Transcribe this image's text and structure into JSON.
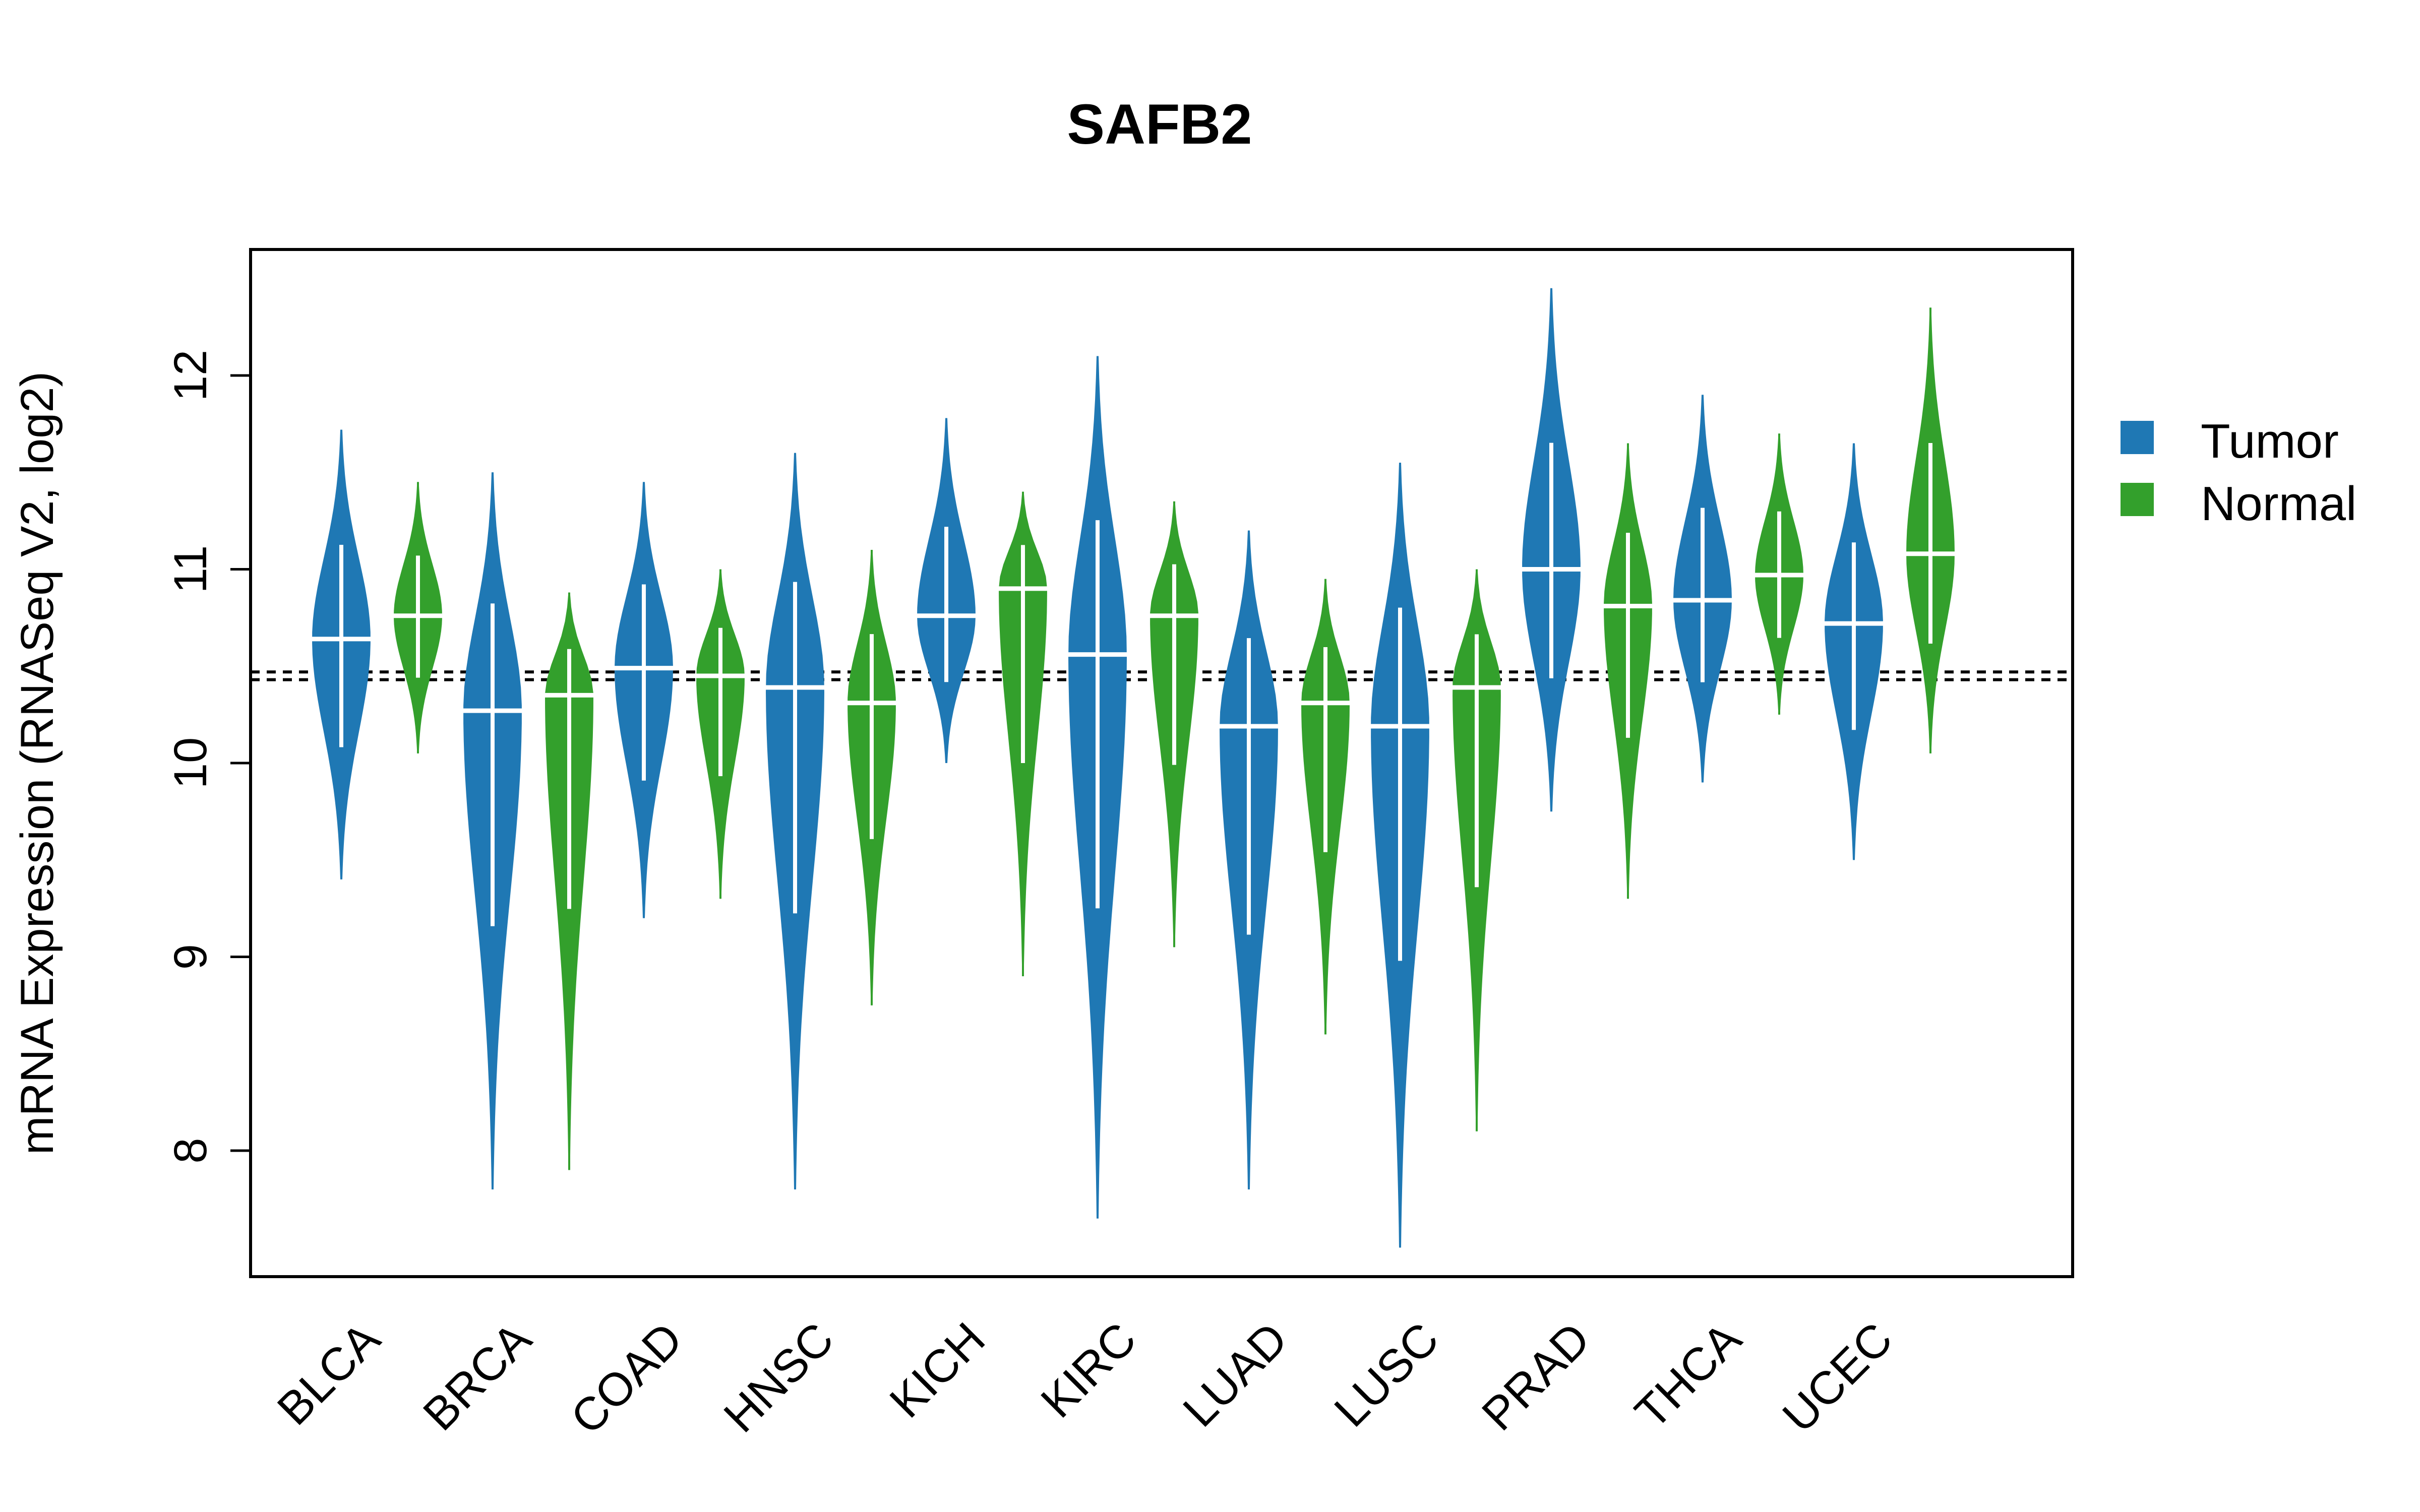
{
  "chart_data": {
    "type": "violin",
    "title": "SAFB2",
    "xlabel": "",
    "ylabel": "mRNA Expression (RNASeq V2, log2)",
    "ylim": [
      7.35,
      12.65
    ],
    "yticks": [
      8,
      9,
      10,
      11,
      12
    ],
    "ytick_labels": [
      "8",
      "9",
      "10",
      "11",
      "12"
    ],
    "grid": false,
    "reference_lines": [
      10.43,
      10.47
    ],
    "legend": {
      "position": "right",
      "entries": [
        {
          "name": "Tumor",
          "color": "#1F78B4"
        },
        {
          "name": "Normal",
          "color": "#33A02C"
        }
      ]
    },
    "categories": [
      "BLCA",
      "BRCA",
      "COAD",
      "HNSC",
      "KICH",
      "KIRC",
      "LUAD",
      "LUSC",
      "PRAD",
      "THCA",
      "UCEC"
    ],
    "series": [
      {
        "name": "Tumor",
        "color": "#1F78B4",
        "median": [
          10.64,
          10.27,
          10.49,
          10.39,
          10.76,
          10.56,
          10.19,
          10.19,
          11.0,
          10.84,
          10.72
        ],
        "min": [
          9.4,
          7.8,
          9.2,
          7.8,
          10.0,
          7.65,
          7.8,
          7.5,
          9.75,
          9.9,
          9.5
        ],
        "max": [
          11.72,
          11.5,
          11.45,
          11.6,
          11.78,
          12.1,
          11.2,
          11.55,
          12.45,
          11.9,
          11.65
        ]
      },
      {
        "name": "Normal",
        "color": "#33A02C",
        "median": [
          10.76,
          10.35,
          10.45,
          10.31,
          10.9,
          10.76,
          10.31,
          10.39,
          10.81,
          10.97,
          11.08
        ],
        "min": [
          10.05,
          7.9,
          9.3,
          8.75,
          8.9,
          9.05,
          8.6,
          8.1,
          9.3,
          10.25,
          10.05
        ],
        "max": [
          11.45,
          10.88,
          11.0,
          11.1,
          11.4,
          11.35,
          10.95,
          11.0,
          11.65,
          11.7,
          12.35
        ]
      }
    ]
  }
}
